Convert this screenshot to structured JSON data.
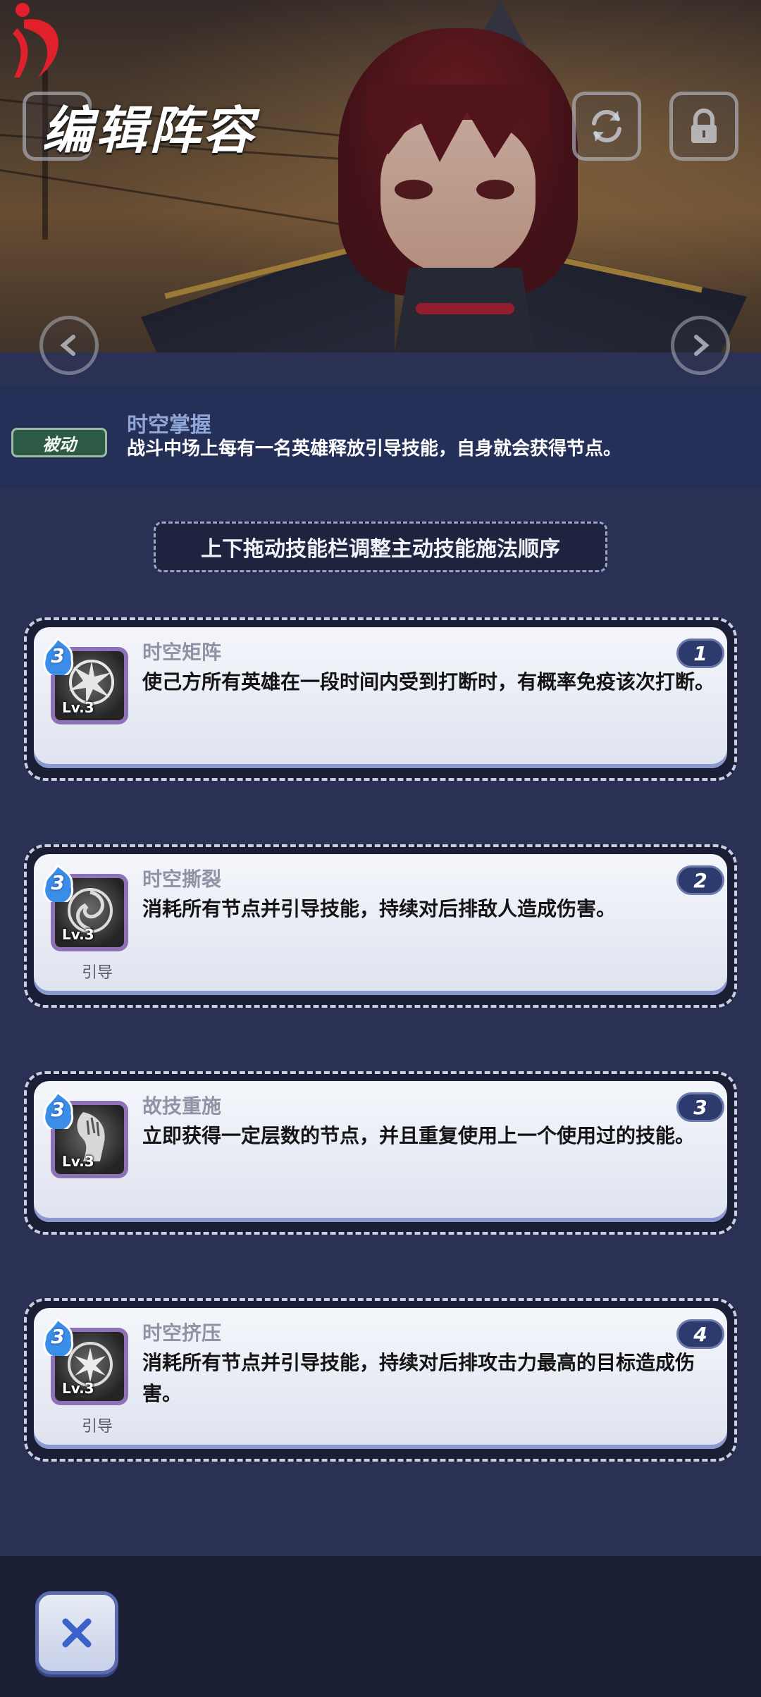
{
  "header": {
    "title": "编辑阵容"
  },
  "passive": {
    "badge": "被动",
    "name": "时空掌握",
    "description": "战斗中场上每有一名英雄释放引导技能，自身就会获得节点。"
  },
  "hint": "上下拖动技能栏调整主动技能施法顺序",
  "skills": [
    {
      "order": "1",
      "level": "3",
      "level_label": "Lv.3",
      "name": "时空矩阵",
      "description": "使己方所有英雄在一段时间内受到打断时，有概率免疫该次打断。",
      "tag": "",
      "icon": "shatter-sphere-icon"
    },
    {
      "order": "2",
      "level": "3",
      "level_label": "Lv.3",
      "name": "时空撕裂",
      "description": "消耗所有节点并引导技能，持续对后排敌人造成伤害。",
      "tag": "引导",
      "icon": "vortex-sphere-icon"
    },
    {
      "order": "3",
      "level": "3",
      "level_label": "Lv.3",
      "name": "故技重施",
      "description": "立即获得一定层数的节点，并且重复使用上一个使用过的技能。",
      "tag": "",
      "icon": "reaching-hand-icon"
    },
    {
      "order": "4",
      "level": "3",
      "level_label": "Lv.3",
      "name": "时空挤压",
      "description": "消耗所有节点并引导技能，持续对后排攻击力最高的目标造成伤害。",
      "tag": "引导",
      "icon": "burst-sphere-icon"
    }
  ],
  "colors": {
    "background": "#2a3154",
    "passive_badge": "#2d5a44",
    "order_badge": "#2c3a6e",
    "level_gem": "#3a8ee8",
    "icon_frame": "#8e72b8"
  }
}
